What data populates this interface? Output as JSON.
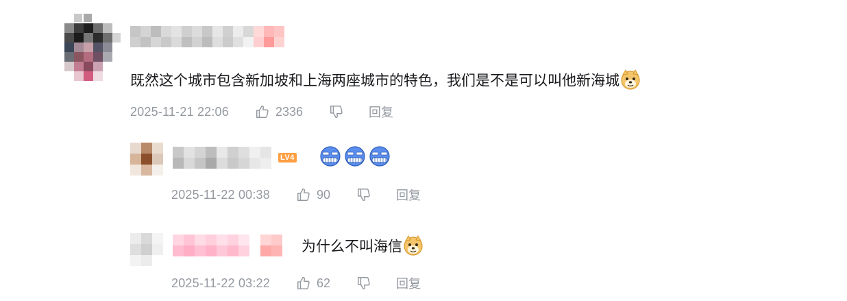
{
  "main_comment": {
    "text": "既然这个城市包含新加坡和上海两座城市的特色，我们是不是可以叫他新海城",
    "emoji": "doge-emoji",
    "time": "2025-11-21 22:06",
    "likes": "2336",
    "reply_label": "回复"
  },
  "replies": [
    {
      "level_badge": "LV4",
      "emoji": "sweat-grimace-emoji",
      "emoji_count": 3,
      "time": "2025-11-22 00:38",
      "likes": "90",
      "reply_label": "回复"
    },
    {
      "text": "为什么不叫海信",
      "emoji": "doge-emoji",
      "time": "2025-11-22 03:22",
      "likes": "62",
      "reply_label": "回复"
    }
  ],
  "colors": {
    "meta_gray": "#9499a0",
    "text_dark": "#18191c",
    "level_orange": "#ff9f43",
    "emoji_blue": "#5b8def"
  }
}
